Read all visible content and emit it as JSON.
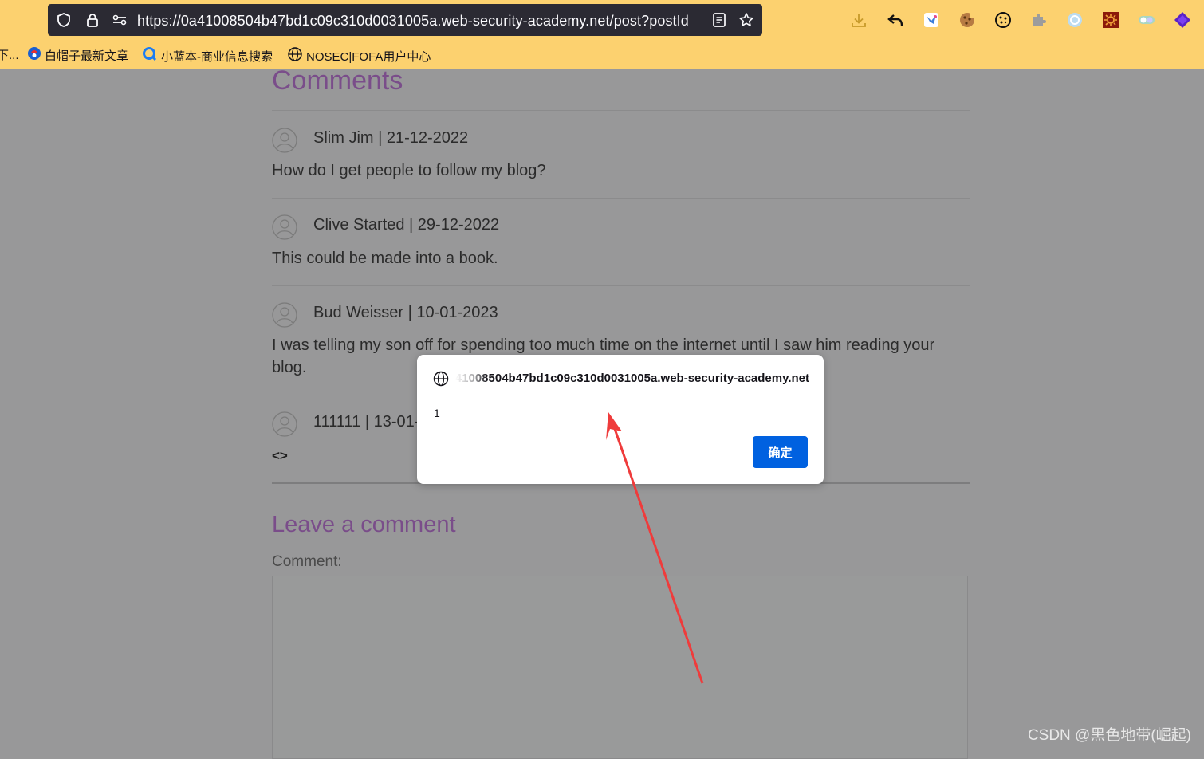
{
  "browser": {
    "url": "https://0a41008504b47bd1c09c310d0031005a.web-security-academy.net/post?postId",
    "bookmarks": [
      {
        "label": "下..."
      },
      {
        "label": "白帽子最新文章"
      },
      {
        "label": "小蓝本-商业信息搜索"
      },
      {
        "label": "NOSEC|FOFA用户中心"
      }
    ]
  },
  "page": {
    "comments_heading": "Comments",
    "comments": [
      {
        "author_line": "Slim Jim | 21-12-2022",
        "text": "How do I get people to follow my blog?"
      },
      {
        "author_line": "Clive Started | 29-12-2022",
        "text": "This could be made into a book."
      },
      {
        "author_line": "Bud Weisser | 10-01-2023",
        "text": "I was telling my son off for spending too much time on the internet until I saw him reading your blog."
      },
      {
        "author_line": "111111 | 13-01-",
        "text": "<>"
      }
    ],
    "leave_heading": "Leave a comment",
    "comment_label": "Comment:"
  },
  "dialog": {
    "origin": "0a41008504b47bd1c09c310d0031005a.web-security-academy.net",
    "message": "1",
    "ok_label": "确定"
  },
  "watermark": "CSDN @黑色地带(崛起)",
  "colors": {
    "chrome_bg": "#fcd16f",
    "urlbar_bg": "#2b2a33",
    "page_overlay": "#989899",
    "heading": "#7a4d8a",
    "ok_button": "#0061e0",
    "annotation_arrow": "#ef3b3b"
  },
  "icons": {
    "urlbar": [
      "shield-icon",
      "lock-icon",
      "permissions-icon",
      "reader-view-icon",
      "bookmark-star-icon"
    ],
    "toolbar": [
      "download-icon",
      "back-arrow-icon",
      "extension-1-icon",
      "cookie-icon",
      "cookie-2-icon",
      "extension-puzzle-icon",
      "circle-extension-icon",
      "sun-extension-icon",
      "toggle-extension-icon",
      "purple-diamond-icon"
    ]
  }
}
